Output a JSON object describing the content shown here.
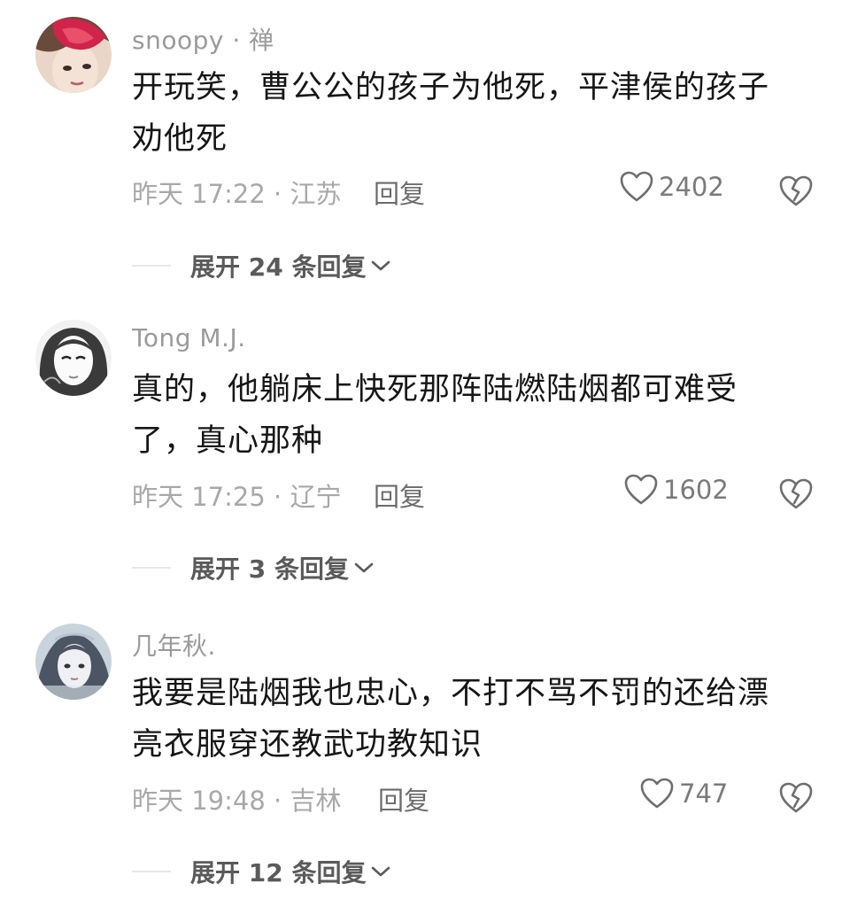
{
  "comments": [
    {
      "username": "snoopy · 禅",
      "text_line1": "开玩笑，曹公公的孩子为他死，平津侯的孩子",
      "text_line2": "劝他死",
      "meta": "昨天 17:22 · 江苏",
      "reply_label": "回复",
      "likes": "2402",
      "expand_label": "展开 24 条回复"
    },
    {
      "username": "Tong M.J.",
      "text_line1": "真的，他躺床上快死那阵陆燃陆烟都可难受",
      "text_line2": "了，真心那种",
      "meta": "昨天 17:25 · 辽宁",
      "reply_label": "回复",
      "likes": "1602",
      "expand_label": "展开 3 条回复"
    },
    {
      "username": "几年秋.",
      "text_line1": "我要是陆烟我也忠心，不打不骂不罚的还给漂",
      "text_line2": "亮衣服穿还教武功教知识",
      "meta": "昨天 19:48 · 吉林",
      "reply_label": "回复",
      "likes": "747",
      "expand_label": "展开 12 条回复"
    }
  ],
  "icons": {
    "like": "heart-outline-icon",
    "dislike": "broken-heart-icon",
    "expand": "chevron-down-icon"
  },
  "colors": {
    "username": "#9a9a9a",
    "body_text": "#161616",
    "meta": "#a8a8a8",
    "reply": "#6b6b6b",
    "icon_stroke": "#6e6e6e"
  }
}
